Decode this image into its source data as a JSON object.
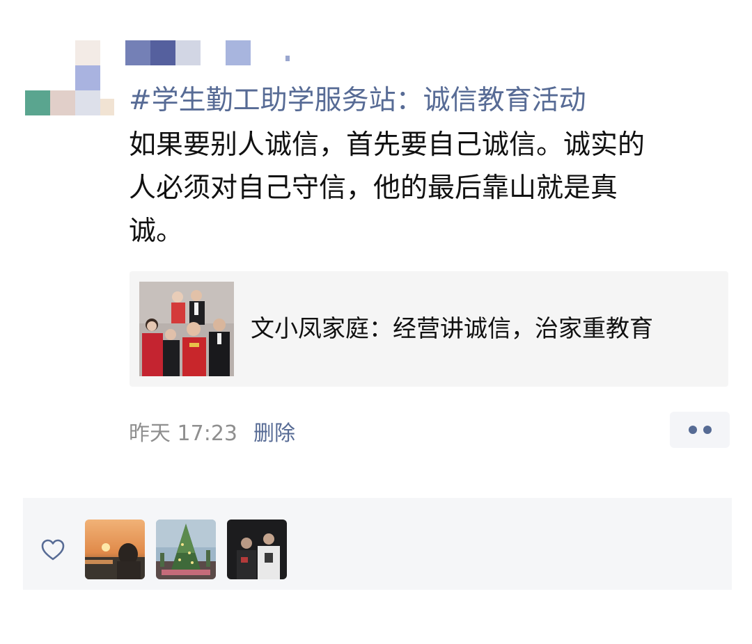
{
  "post": {
    "topic": "#学生勤工助学服务站：诚信教育活动",
    "body_lines": [
      "如果要别人诚信，首先要自己诚信。诚实的",
      "人必须对自己守信，他的最后靠山就是真",
      "诚。"
    ],
    "link_card": {
      "title": "文小凤家庭：经营讲诚信，治家重教育"
    },
    "time": "昨天 17:23",
    "delete_label": "删除"
  },
  "likes": {
    "icon": "heart-outline-icon"
  },
  "colors": {
    "link_blue": "#576b95",
    "card_bg": "#f5f5f5",
    "likes_bg": "#f5f6f8"
  }
}
